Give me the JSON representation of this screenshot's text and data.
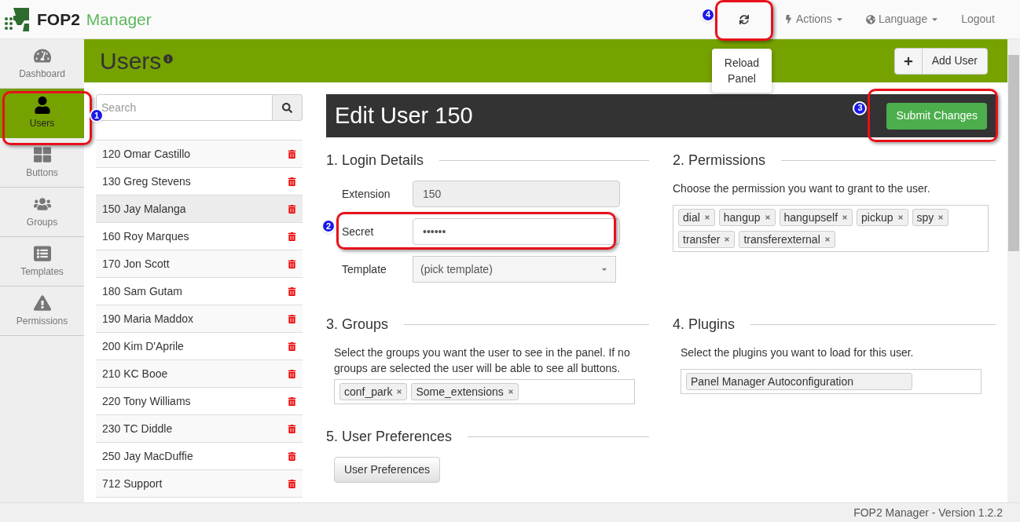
{
  "navbar": {
    "brand": {
      "bold": "FOP2",
      "light": "Manager"
    },
    "reload": {
      "annotation": "4",
      "tooltip": "Reload Panel"
    },
    "menus": [
      {
        "kind": "dropdown",
        "label": "Actions"
      },
      {
        "kind": "dropdown",
        "label": "Language"
      },
      {
        "kind": "link",
        "label": "Logout"
      }
    ]
  },
  "sidebar": {
    "items": [
      {
        "label": "Dashboard",
        "selected": false
      },
      {
        "label": "Users",
        "selected": true,
        "annotation": "1"
      },
      {
        "label": "Buttons",
        "selected": false
      },
      {
        "label": "Groups",
        "selected": false
      },
      {
        "label": "Templates",
        "selected": false
      },
      {
        "label": "Permissions",
        "selected": false
      }
    ]
  },
  "page_header": {
    "title": "Users",
    "add_button": "Add User"
  },
  "user_list": {
    "search": {
      "placeholder": "Search"
    },
    "users": [
      {
        "label": "120 Omar Castillo",
        "selected": false
      },
      {
        "label": "130 Greg Stevens",
        "selected": false
      },
      {
        "label": "150 Jay Malanga",
        "selected": true
      },
      {
        "label": "160 Roy Marques",
        "selected": false
      },
      {
        "label": "170 Jon Scott",
        "selected": false
      },
      {
        "label": "180 Sam Gutam",
        "selected": false
      },
      {
        "label": "190 Maria Maddox",
        "selected": false
      },
      {
        "label": "200 Kim D'Aprile",
        "selected": false
      },
      {
        "label": "210 KC Booe",
        "selected": false
      },
      {
        "label": "220 Tony Williams",
        "selected": false
      },
      {
        "label": "230 TC Diddle",
        "selected": false
      },
      {
        "label": "250 Jay MacDuffie",
        "selected": false
      },
      {
        "label": "712 Support",
        "selected": false
      }
    ]
  },
  "editor": {
    "title": "Edit User 150",
    "submit": {
      "label": "Submit Changes",
      "annotation": "3"
    },
    "login": {
      "heading": "1. Login Details",
      "fields": [
        {
          "kind": "readonly",
          "label": "Extension",
          "value": "150"
        },
        {
          "kind": "password",
          "label": "Secret",
          "value": "••••••",
          "annotation": "2"
        },
        {
          "kind": "select",
          "label": "Template",
          "value": "(pick template)"
        }
      ]
    },
    "permissions": {
      "heading": "2. Permissions",
      "description": "Choose the permission you want to grant to the user.",
      "tags": [
        {
          "label": "dial",
          "removable": true
        },
        {
          "label": "hangup",
          "removable": true
        },
        {
          "label": "hangupself",
          "removable": true
        },
        {
          "label": "pickup",
          "removable": true
        },
        {
          "label": "spy",
          "removable": true
        },
        {
          "label": "transfer",
          "removable": true
        },
        {
          "label": "transferexternal",
          "removable": true
        }
      ]
    },
    "groups": {
      "heading": "3. Groups",
      "description": "Select the groups you want the user to see in the panel. If no groups are selected the user will be able to see all buttons.",
      "tags": [
        {
          "label": "conf_park",
          "removable": true
        },
        {
          "label": "Some_extensions",
          "removable": true
        }
      ]
    },
    "plugins": {
      "heading": "4. Plugins",
      "description": "Select the plugins you want to load for this user.",
      "tags": [
        {
          "label": "Panel Manager Autoconfiguration",
          "removable": false
        }
      ]
    },
    "preferences": {
      "heading": "5. User Preferences",
      "button": "User Preferences"
    }
  },
  "footer": "FOP2 Manager - Version 1.2.2"
}
